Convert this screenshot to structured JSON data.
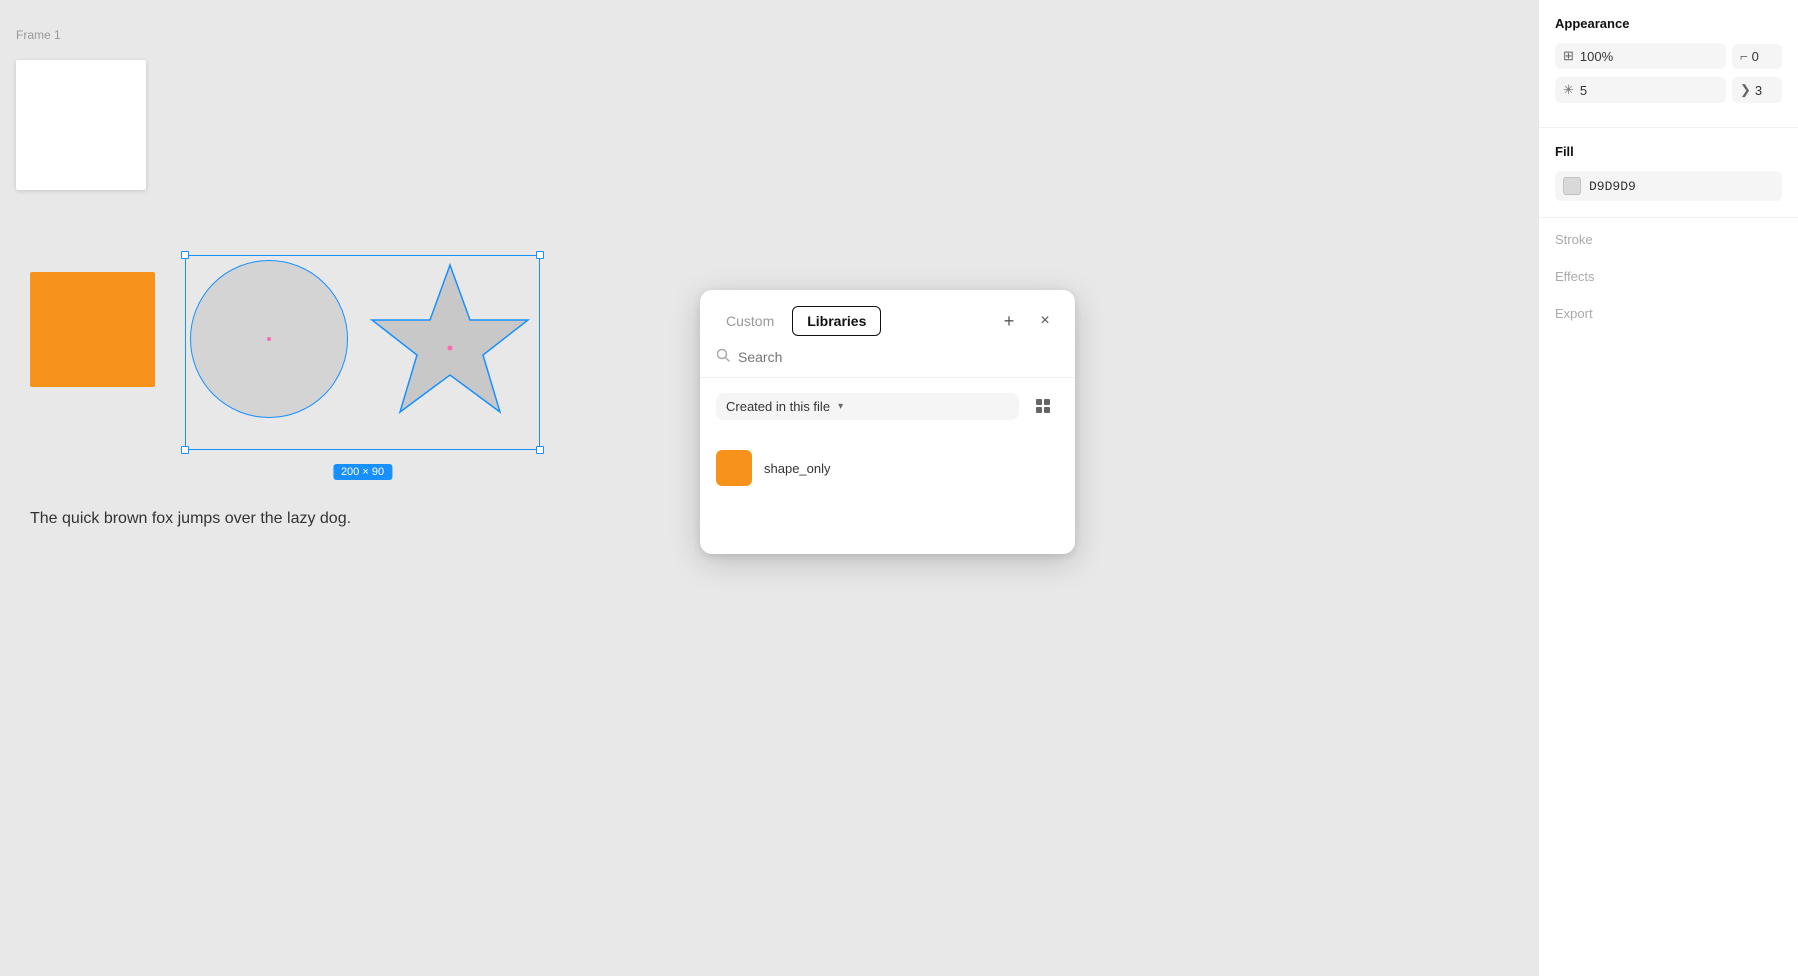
{
  "frame": {
    "label": "Frame 1"
  },
  "canvas": {
    "dimension_label": "200 × 90",
    "text": "The quick brown fox jumps over the lazy dog."
  },
  "library_modal": {
    "tab_custom": "Custom",
    "tab_libraries": "Libraries",
    "plus_icon": "+",
    "close_icon": "×",
    "search_placeholder": "Search",
    "filter_label": "Created in this file",
    "items": [
      {
        "name": "shape_only",
        "color": "#F7931A"
      }
    ]
  },
  "right_panel": {
    "appearance_title": "Appearance",
    "opacity_value": "100%",
    "corner_radius_value": "0",
    "blur_value": "5",
    "blend_value": "3",
    "fill_title": "Fill",
    "fill_hex": "D9D9D9",
    "stroke_label": "Stroke",
    "effects_label": "Effects",
    "export_label": "Export"
  }
}
